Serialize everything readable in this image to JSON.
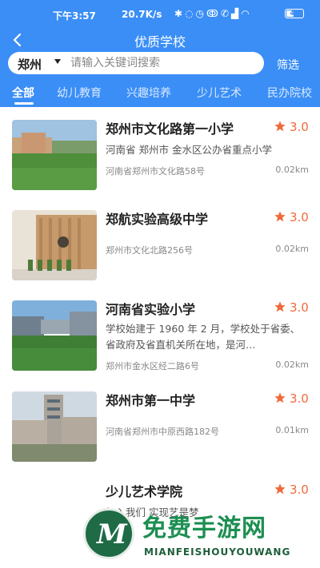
{
  "status_bar": {
    "time": "下午3:57",
    "network_speed": "20.7K/s",
    "icons": [
      "signal-icon",
      "bluetooth-icon",
      "mute-icon",
      "alarm-icon",
      "nfc-icon",
      "call-icon",
      "cellular-icon",
      "wifi-icon"
    ],
    "battery": "49"
  },
  "header": {
    "title": "优质学校",
    "back_icon": "back-arrow-icon"
  },
  "search": {
    "city": "郑州",
    "placeholder": "请输入关键词搜索",
    "filter_label": "筛选"
  },
  "tabs": [
    {
      "label": "全部",
      "active": true
    },
    {
      "label": "幼儿教育",
      "active": false
    },
    {
      "label": "兴趣培养",
      "active": false
    },
    {
      "label": "少儿艺术",
      "active": false
    },
    {
      "label": "民办院校",
      "active": false
    }
  ],
  "schools": [
    {
      "name": "郑州市文化路第一小学",
      "rating": "3.0",
      "description": "河南省 郑州市 金水区公办省重点小学",
      "address": "河南省郑州市文化路58号",
      "distance": "0.02km",
      "has_image": true
    },
    {
      "name": "郑航实验高级中学",
      "rating": "3.0",
      "description": "",
      "address": "郑州市文化北路256号",
      "distance": "0.02km",
      "has_image": true
    },
    {
      "name": "河南省实验小学",
      "rating": "3.0",
      "description": "学校始建于 1960 年 2 月，学校处于省委、省政府及省直机关所在地，是河…",
      "address": "郑州市金水区经二路6号",
      "distance": "0.02km",
      "has_image": true
    },
    {
      "name": "郑州市第一中学",
      "rating": "3.0",
      "description": "",
      "address": "河南省郑州市中原西路182号",
      "distance": "0.01km",
      "has_image": true
    },
    {
      "name": "少儿艺术学院",
      "rating": "3.0",
      "description": "加入我们 实现艺是梦",
      "address": "",
      "distance": "",
      "has_image": false
    }
  ],
  "colors": {
    "brand": "#3a8ef6",
    "rating": "#f06a3a"
  },
  "watermark": {
    "title": "免费手游网",
    "subtitle": "MIANFEISHOUYOUWANG"
  }
}
